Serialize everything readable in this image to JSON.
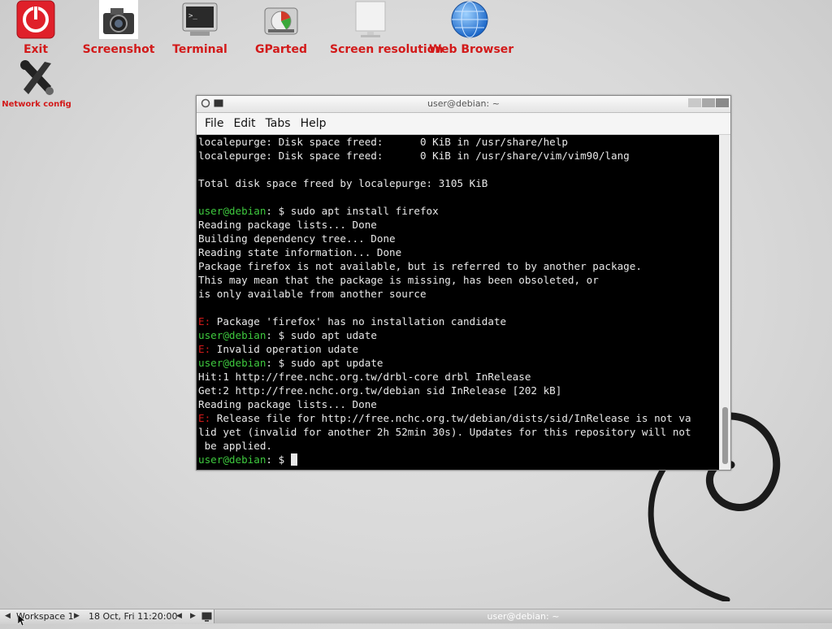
{
  "desktop": {
    "icons": [
      {
        "label": "Exit",
        "icon": "power-icon"
      },
      {
        "label": "Screenshot",
        "icon": "camera-icon"
      },
      {
        "label": "Terminal",
        "icon": "terminal-icon"
      },
      {
        "label": "GParted",
        "icon": "disk-icon"
      },
      {
        "label": "Screen resolution",
        "icon": "monitor-icon"
      },
      {
        "label": "Web Browser",
        "icon": "globe-icon"
      },
      {
        "label": "Network config",
        "icon": "wrench-icon"
      }
    ],
    "label_color": "#d21a1a"
  },
  "window": {
    "title": "user@debian: ~",
    "menu": [
      "File",
      "Edit",
      "Tabs",
      "Help"
    ]
  },
  "terminal": {
    "prompt": "user@debian",
    "prompt_suffix": ": $ ",
    "lines": [
      {
        "type": "out",
        "text": "localepurge: Disk space freed:      0 KiB in /usr/share/help"
      },
      {
        "type": "out",
        "text": "localepurge: Disk space freed:      0 KiB in /usr/share/vim/vim90/lang"
      },
      {
        "type": "out",
        "text": ""
      },
      {
        "type": "out",
        "text": "Total disk space freed by localepurge: 3105 KiB"
      },
      {
        "type": "out",
        "text": ""
      },
      {
        "type": "cmd",
        "text": "sudo apt install firefox"
      },
      {
        "type": "out",
        "text": "Reading package lists... Done"
      },
      {
        "type": "out",
        "text": "Building dependency tree... Done"
      },
      {
        "type": "out",
        "text": "Reading state information... Done"
      },
      {
        "type": "out",
        "text": "Package firefox is not available, but is referred to by another package."
      },
      {
        "type": "out",
        "text": "This may mean that the package is missing, has been obsoleted, or"
      },
      {
        "type": "out",
        "text": "is only available from another source"
      },
      {
        "type": "out",
        "text": ""
      },
      {
        "type": "err",
        "text": "Package 'firefox' has no installation candidate"
      },
      {
        "type": "cmd",
        "text": "sudo apt udate"
      },
      {
        "type": "err",
        "text": "Invalid operation udate"
      },
      {
        "type": "cmd",
        "text": "sudo apt update"
      },
      {
        "type": "out",
        "text": "Hit:1 http://free.nchc.org.tw/drbl-core drbl InRelease"
      },
      {
        "type": "out",
        "text": "Get:2 http://free.nchc.org.tw/debian sid InRelease [202 kB]"
      },
      {
        "type": "out",
        "text": "Reading package lists... Done"
      },
      {
        "type": "err",
        "text": "Release file for http://free.nchc.org.tw/debian/dists/sid/InRelease is not va"
      },
      {
        "type": "out",
        "text": "lid yet (invalid for another 2h 52min 30s). Updates for this repository will not"
      },
      {
        "type": "out",
        "text": " be applied."
      },
      {
        "type": "cmd",
        "text": ""
      }
    ],
    "error_prefix": "E: ",
    "cursor": true
  },
  "taskbar": {
    "workspace": "Workspace 1",
    "clock": "18 Oct, Fri 11:20:00",
    "task_title": "user@debian: ~"
  }
}
